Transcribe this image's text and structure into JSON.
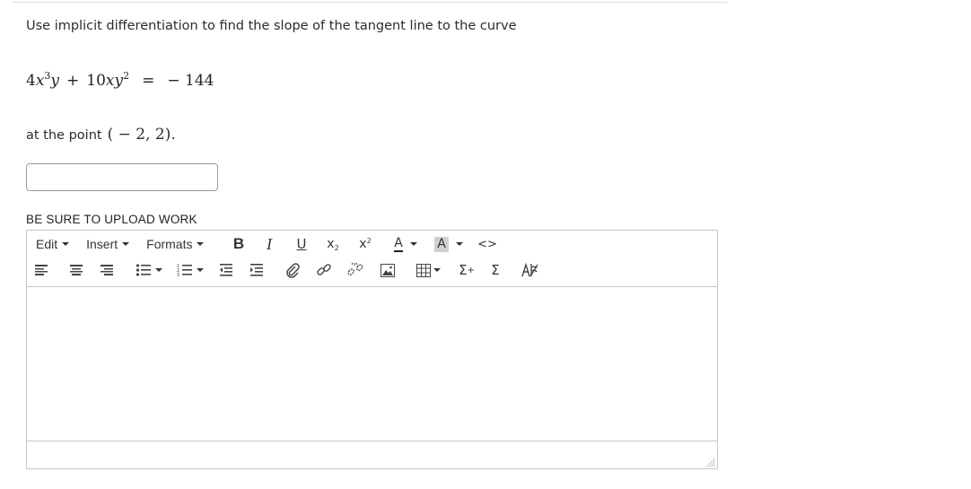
{
  "question": {
    "prompt": "Use implicit differentiation to find the slope of the tangent line to the curve",
    "point_prefix": "at the point",
    "point_math": "( − 2, 2)."
  },
  "equation": {
    "coef1": "4",
    "coef2": "10",
    "rhs": "− 144"
  },
  "answer": {
    "value": ""
  },
  "upload_label": "BE SURE TO UPLOAD WORK",
  "editor": {
    "menus": {
      "edit": "Edit",
      "insert": "Insert",
      "formats": "Formats"
    },
    "toolbar_icons": [
      "bold-icon",
      "italic-icon",
      "underline-icon",
      "subscript-icon",
      "superscript-icon",
      "text-color-icon",
      "background-color-icon",
      "source-code-icon",
      "align-left-icon",
      "align-center-icon",
      "align-right-icon",
      "bullet-list-icon",
      "numbered-list-icon",
      "outdent-icon",
      "indent-icon",
      "attachment-icon",
      "link-icon",
      "unlink-icon",
      "image-icon",
      "table-icon",
      "equation-icon",
      "sum-icon",
      "special-character-icon"
    ],
    "content": ""
  }
}
